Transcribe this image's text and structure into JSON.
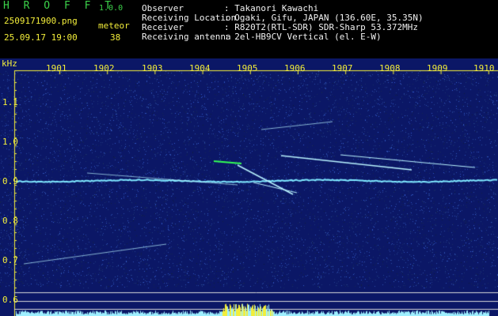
{
  "header": {
    "app_title": "H R O F F T",
    "app_version": "1.0.0",
    "filename": "2509171900.png",
    "meteor_label": "meteor",
    "datetime": "25.09.17 19:00",
    "meteor_count": "38",
    "meta": [
      {
        "key": "Observer",
        "value": ": Takanori Kawachi"
      },
      {
        "key": "Receiving Location",
        "value": ": Ogaki, Gifu, JAPAN (136.60E, 35.35N)"
      },
      {
        "key": "Receiver",
        "value": ": R820T2(RTL-SDR) SDR-Sharp 53.372MHz"
      },
      {
        "key": "Receiving antenna",
        "value": ": 2el-HB9CV Vertical (el. E-W)"
      }
    ]
  },
  "spectrogram": {
    "unit_label": "kHz",
    "time_ticks": [
      "1901",
      "1902",
      "1903",
      "1904",
      "1905",
      "1906",
      "1907",
      "1908",
      "1909",
      "1910"
    ],
    "freq_ticks": [
      "1.1",
      "1.0",
      "0.9",
      "0.8",
      "0.7",
      "0.6"
    ],
    "colors": {
      "background": "#0b1766",
      "axis": "#f3ee3a",
      "carrier": "#7fe8ff",
      "trace": "#b9f3ff",
      "peak": "#33ff55",
      "level": "#9ff0ff",
      "level_burst": "#f3ee3a"
    }
  }
}
